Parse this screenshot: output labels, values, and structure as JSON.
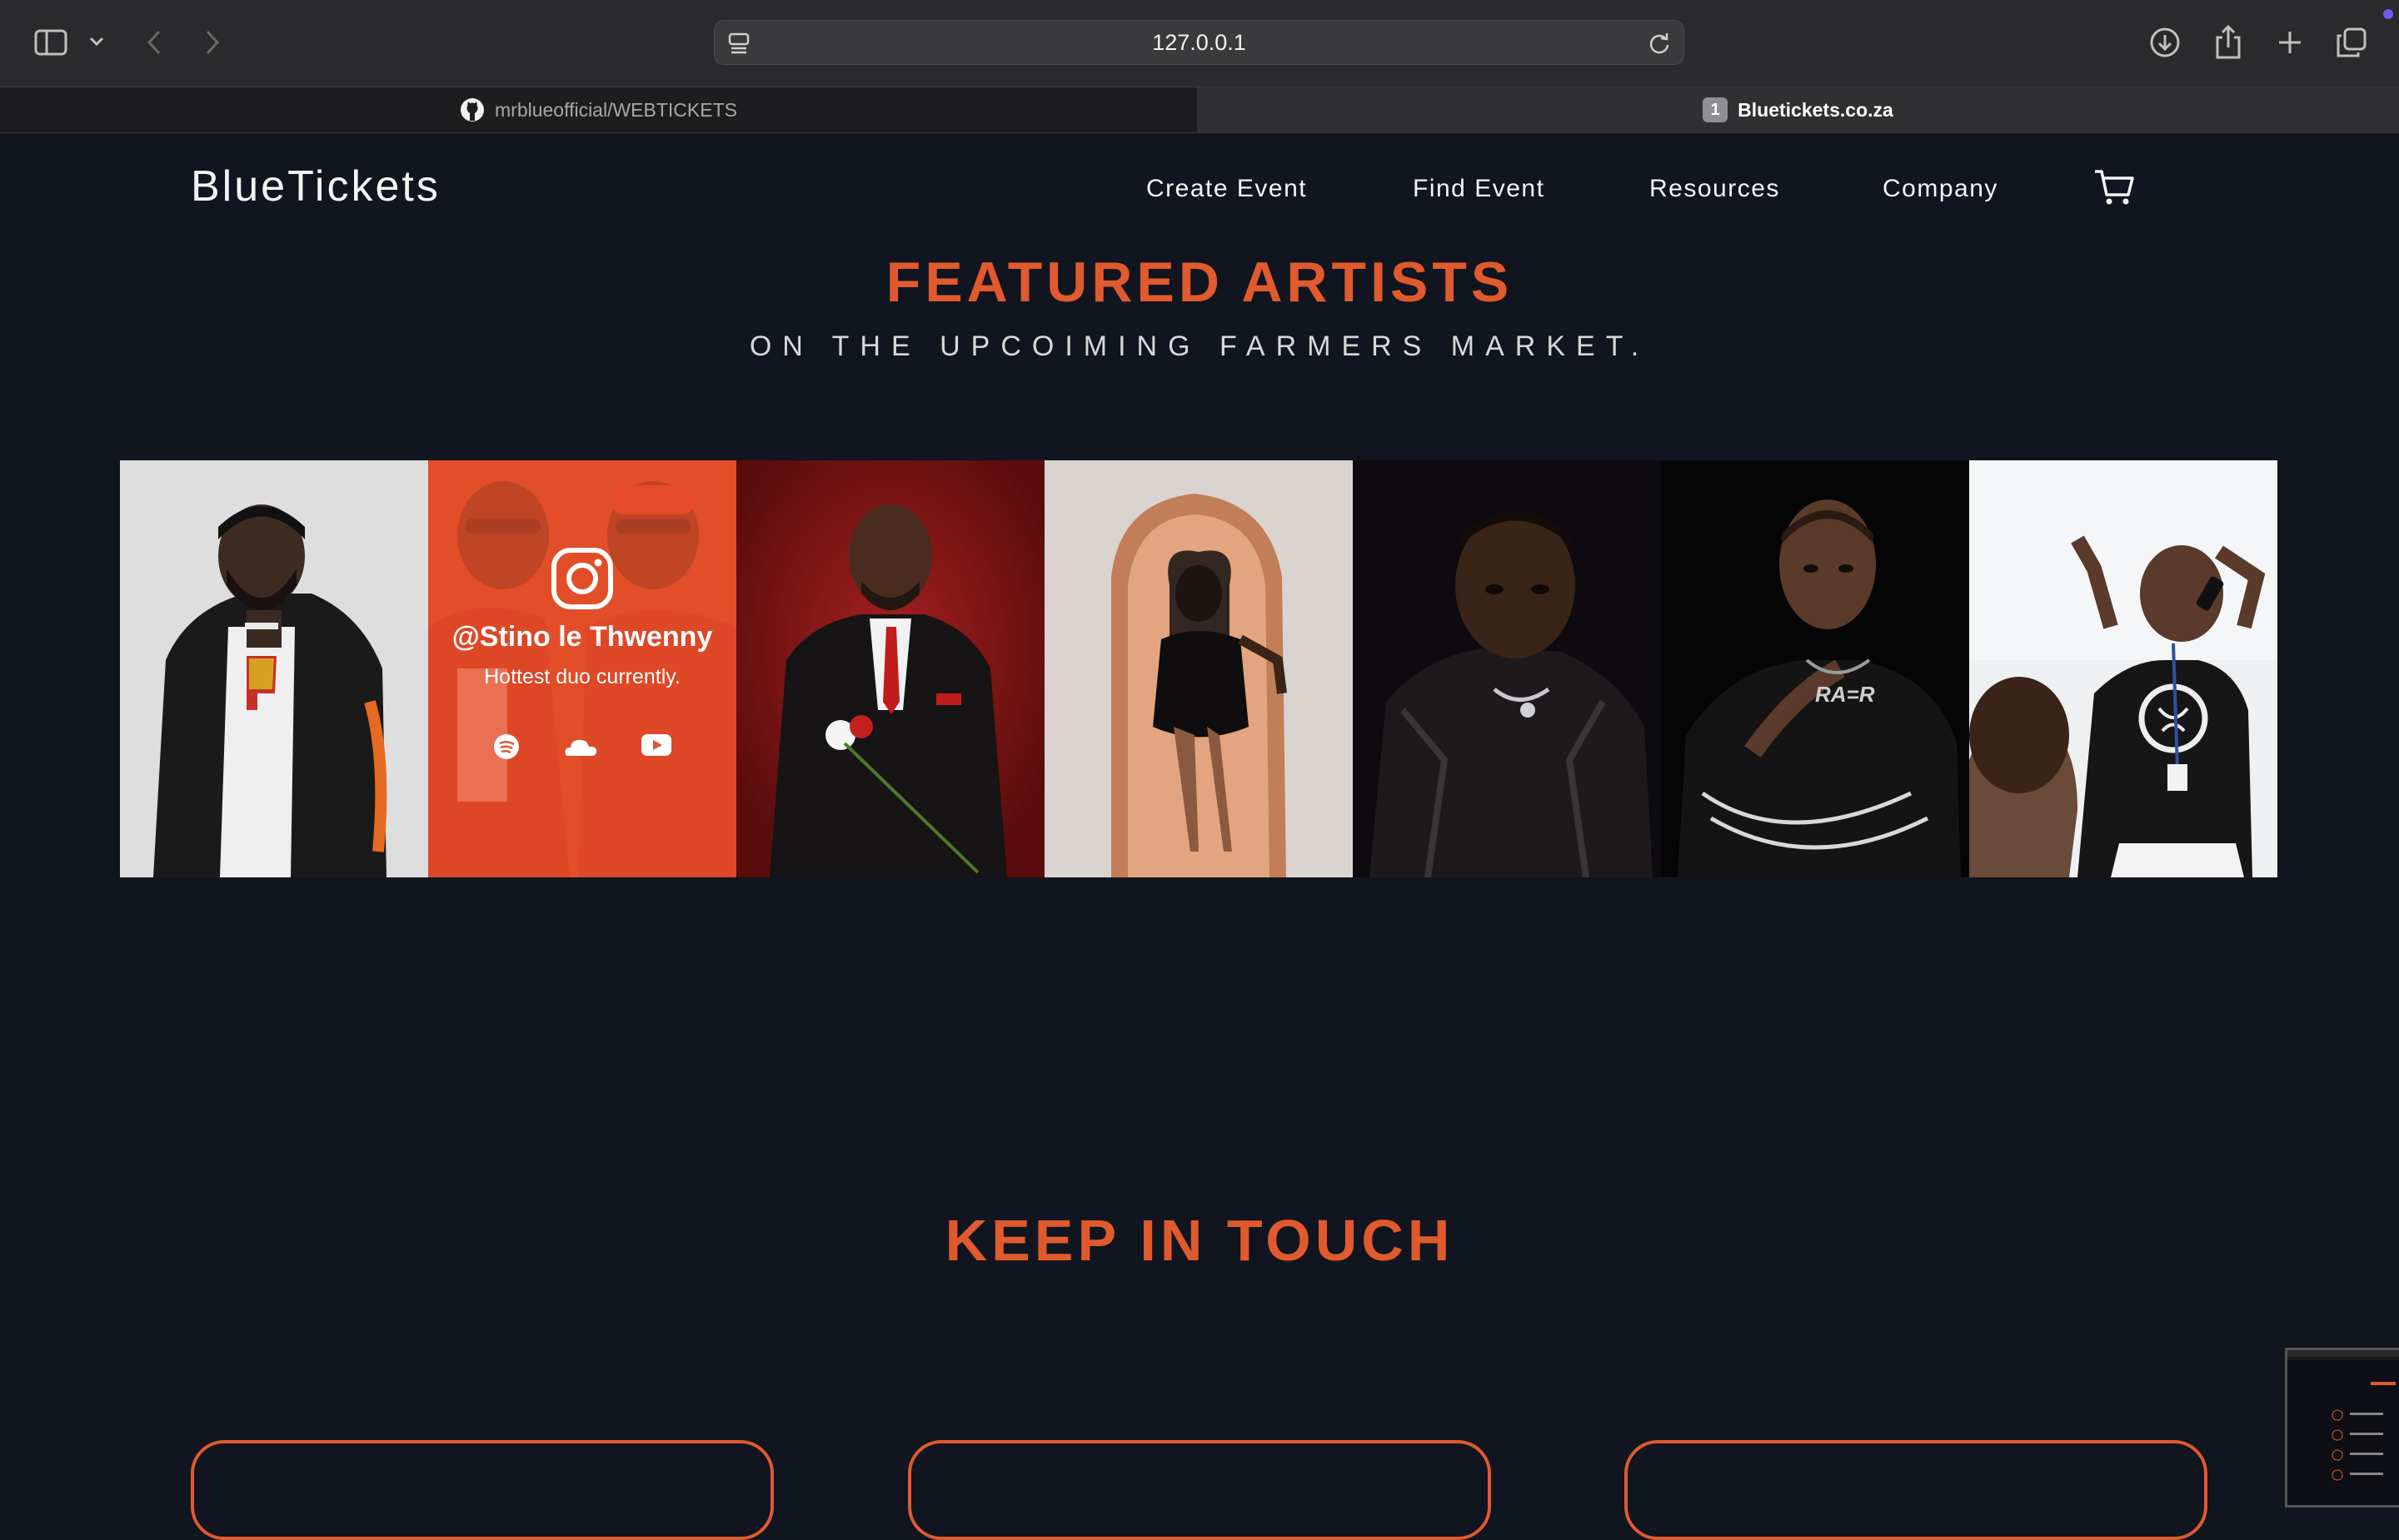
{
  "browser": {
    "url": "127.0.0.1",
    "tabs": [
      {
        "label": "mrblueofficial/WEBTICKETS",
        "icon": "github-icon",
        "active": false
      },
      {
        "label": "Bluetickets.co.za",
        "badge": "1",
        "active": true
      }
    ]
  },
  "site": {
    "logo": "BlueTickets",
    "nav": [
      "Create Event",
      "Find Event",
      "Resources",
      "Company"
    ],
    "cart_icon": "cart-icon"
  },
  "featured": {
    "title": "FEATURED ARTISTS",
    "subtitle": "ON THE UPCOIMING FARMERS MARKET.",
    "overlay": {
      "handle": "@Stino le Thwenny",
      "caption": "Hottest duo currently.",
      "icons": [
        "instagram-icon",
        "spotify-icon",
        "soundcloud-icon",
        "youtube-icon"
      ]
    }
  },
  "contact": {
    "title": "KEEP IN TOUCH"
  },
  "colors": {
    "accent": "#e05a2e",
    "page_bg": "#111520",
    "chrome_bg": "#2a2a2c"
  }
}
